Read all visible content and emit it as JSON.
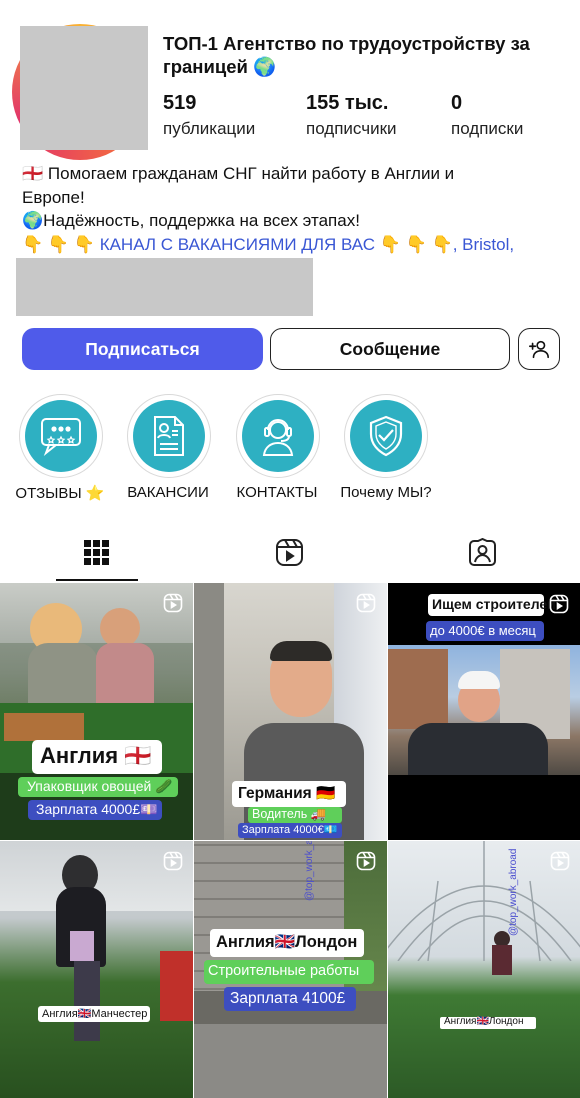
{
  "profile": {
    "title_line1": "ТОП-1 Агентство по трудоустройству за",
    "title_line2": "границей 🌍",
    "stats": [
      {
        "value": "519",
        "label": "публикации"
      },
      {
        "value": "155 тыс.",
        "label": "подписчики"
      },
      {
        "value": "0",
        "label": "подписки"
      }
    ],
    "bio_line1": "🏴󠁧󠁢󠁥󠁮󠁧󠁿 Помогаем гражданам СНГ найти работу в Англии и",
    "bio_line2": "Европе!",
    "bio_line3": "🌍Надёжность, поддержка на всех этапах!",
    "bio_line4_emoji_left": "👇 👇 👇",
    "bio_line4_link": "КАНАЛ С ВАКАНСИЯМИ ДЛЯ ВАС",
    "bio_line4_emoji_right": "👇 👇 👇",
    "bio_line4_location": ", Bristol,"
  },
  "actions": {
    "follow": "Подписаться",
    "message": "Сообщение"
  },
  "highlights": [
    {
      "label": "ОТЗЫВЫ ⭐",
      "icon": "reviews-chat-icon"
    },
    {
      "label": "ВАКАНСИИ",
      "icon": "resume-document-icon"
    },
    {
      "label": "КОНТАКТЫ",
      "icon": "headset-operator-icon"
    },
    {
      "label": "Почему МЫ?",
      "icon": "shield-check-icon"
    }
  ],
  "tabs": [
    "grid-icon",
    "reels-icon",
    "tagged-icon"
  ],
  "posts": [
    {
      "title": "Англия 🏴󠁧󠁢󠁥󠁮󠁧󠁿",
      "subtitle": "Упаковщик овощей 🥒",
      "salary": "Зарплата 4000£💷"
    },
    {
      "title": "Германия 🇩🇪",
      "subtitle": "Водитель 🚚",
      "salary": "Зарплата 4000€💶"
    },
    {
      "title": "Ищем строителей",
      "subtitle": "до 4000€ в месяц",
      "salary": ""
    },
    {
      "title": "Англия🇬🇧Манчестер",
      "subtitle": "",
      "salary": ""
    },
    {
      "title": "Англия🇬🇧Лондон",
      "subtitle": "Строительные работы",
      "salary": "Зарплата 4100£",
      "watermark": "@top_work_abroad"
    },
    {
      "title": "Англия🇬🇧Лондон",
      "subtitle": "",
      "salary": "",
      "watermark": "@top_work_abroad"
    }
  ],
  "colors": {
    "accent": "#4f5bea",
    "highlight": "#2eb0c2",
    "link": "#3a57d4"
  }
}
